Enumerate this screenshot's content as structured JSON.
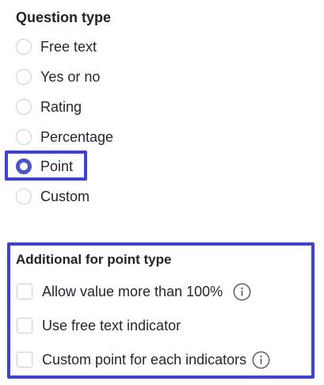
{
  "question_type": {
    "title": "Question type",
    "options": [
      {
        "label": "Free text",
        "selected": false
      },
      {
        "label": "Yes or no",
        "selected": false
      },
      {
        "label": "Rating",
        "selected": false
      },
      {
        "label": "Percentage",
        "selected": false
      },
      {
        "label": "Point",
        "selected": true
      },
      {
        "label": "Custom",
        "selected": false
      }
    ],
    "selected_value": "Point"
  },
  "point_settings": {
    "title": "Additional for point type",
    "options": [
      {
        "label": "Allow value more than 100%",
        "checked": false,
        "has_info": true
      },
      {
        "label": "Use free text indicator",
        "checked": false,
        "has_info": false
      },
      {
        "label": "Custom point for each indicators",
        "checked": false,
        "has_info": true
      }
    ]
  },
  "colors": {
    "accent": "#4b55c8",
    "highlight_border": "#3e43c9",
    "control_border": "#c9ced6",
    "text": "#23272e"
  },
  "icons": {
    "info": "info-circle-icon"
  }
}
